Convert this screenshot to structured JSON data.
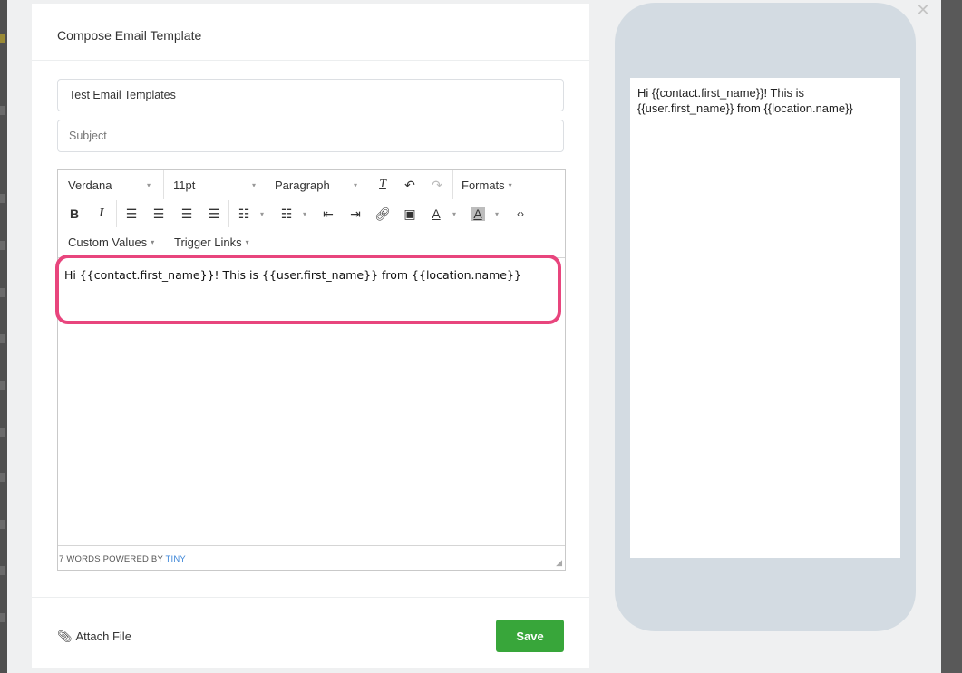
{
  "modal": {
    "title": "Compose Email Template",
    "close_icon": "close-icon"
  },
  "form": {
    "template_name": {
      "value": "Test Email Templates",
      "placeholder": ""
    },
    "subject": {
      "value": "",
      "placeholder": "Subject"
    }
  },
  "editor": {
    "toolbar": {
      "font_family": "Verdana",
      "font_size": "11pt",
      "block_format": "Paragraph",
      "formats_label": "Formats",
      "custom_values_label": "Custom Values",
      "trigger_links_label": "Trigger Links",
      "icons": [
        "clear-formatting-icon",
        "undo-icon",
        "redo-icon",
        "bold-icon",
        "italic-icon",
        "align-left-icon",
        "align-center-icon",
        "align-right-icon",
        "align-justify-icon",
        "bullet-list-icon",
        "numbered-list-icon",
        "outdent-icon",
        "indent-icon",
        "link-icon",
        "image-icon",
        "text-color-icon",
        "background-color-icon",
        "source-code-icon"
      ]
    },
    "content": "Hi  {{contact.first_name}}! This is {{user.first_name}} from {{location.name}}",
    "status": {
      "word_count": "7 WORDS",
      "powered_by": "POWERED BY",
      "tiny": "TINY"
    }
  },
  "footer": {
    "attach_label": "Attach File",
    "save_label": "Save"
  },
  "preview": {
    "text": "Hi  {{contact.first_name}}! This is {{user.first_name}} from {{location.name}}"
  },
  "colors": {
    "save_button": "#38a63a",
    "highlight_border": "#e8457d",
    "tiny_link": "#3d86d8",
    "phone_frame": "#d3dbe2"
  }
}
